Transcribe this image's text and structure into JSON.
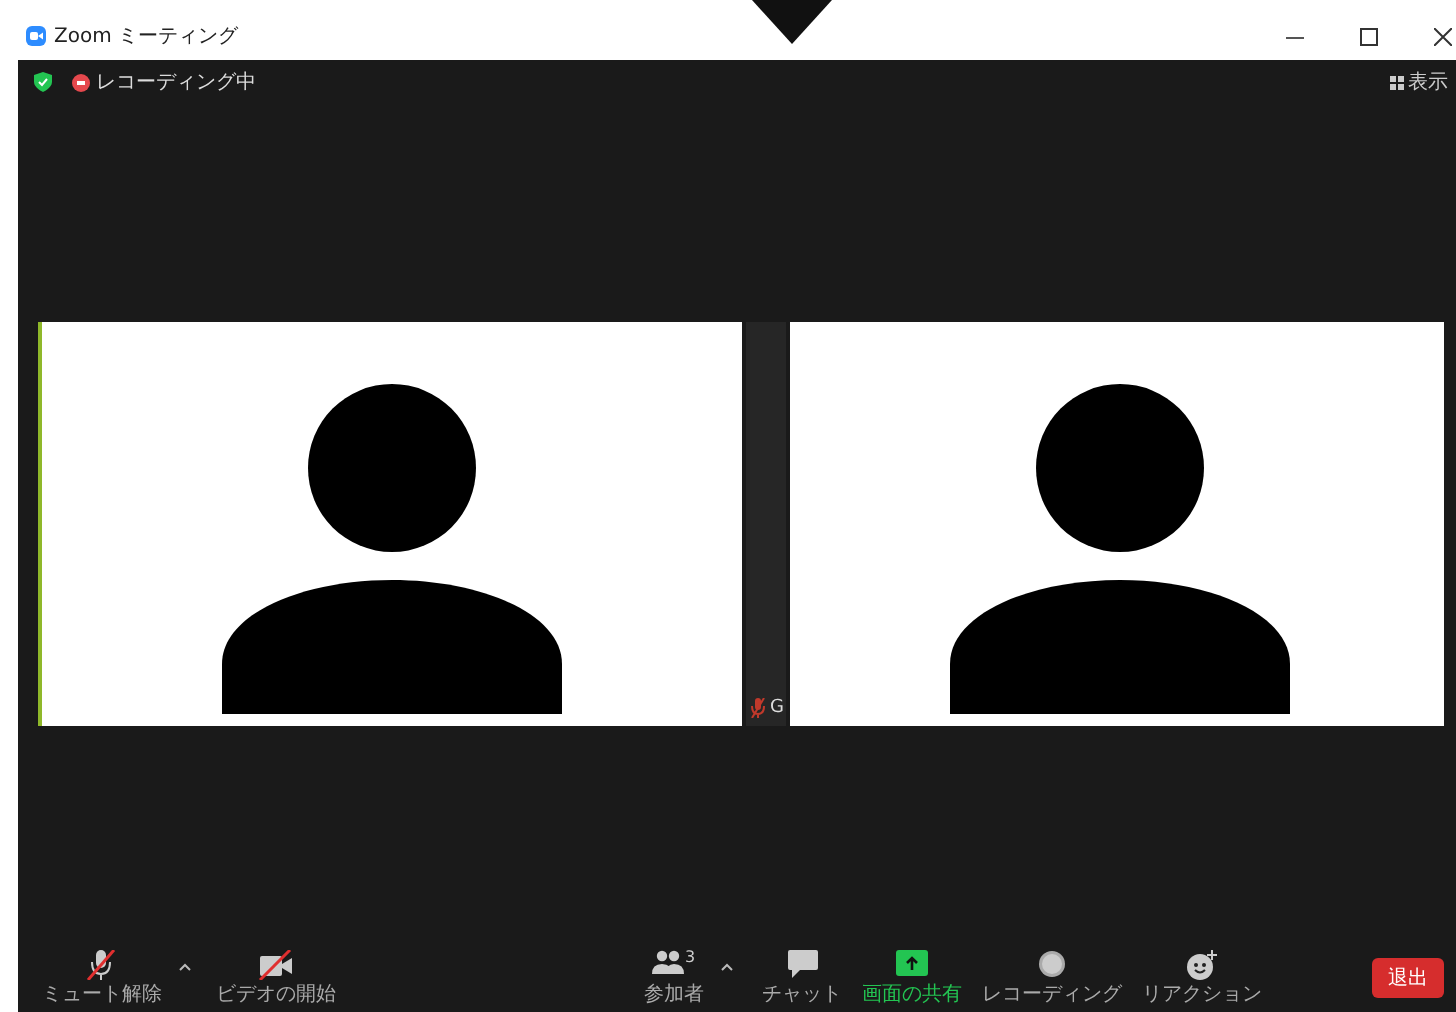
{
  "window": {
    "title": "Zoom ミーティング"
  },
  "top_bar": {
    "recording_label": "レコーディング中",
    "view_button": "表示"
  },
  "tiles": [
    {
      "kind": "video",
      "speaking": true
    },
    {
      "kind": "strip",
      "name": "G",
      "muted": true
    },
    {
      "kind": "video",
      "speaking": false
    }
  ],
  "toolbar": {
    "left": [
      {
        "kind": "mic",
        "label": "ミュート解除",
        "caret": true
      },
      {
        "kind": "camera",
        "label": "ビデオの開始",
        "caret": false
      }
    ],
    "center": [
      {
        "kind": "participants",
        "label": "参加者",
        "count": "3",
        "caret": true
      },
      {
        "kind": "chat",
        "label": "チャット",
        "caret": false
      },
      {
        "kind": "share",
        "label": "画面の共有",
        "caret": false
      },
      {
        "kind": "record",
        "label": "レコーディング",
        "caret": false
      },
      {
        "kind": "reaction",
        "label": "リアクション",
        "caret": false
      }
    ],
    "leave_button": "退出"
  }
}
